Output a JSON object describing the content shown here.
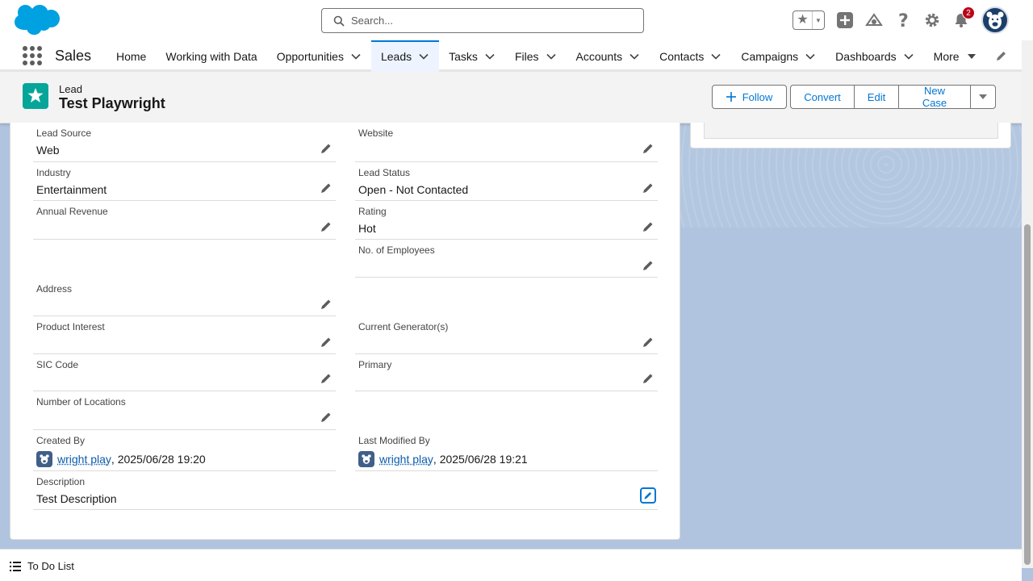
{
  "header": {
    "search_placeholder": "Search...",
    "notification_count": "2"
  },
  "nav": {
    "app_name": "Sales",
    "items": [
      {
        "label": "Home",
        "dropdown": false,
        "active": false
      },
      {
        "label": "Working with Data",
        "dropdown": false,
        "active": false
      },
      {
        "label": "Opportunities",
        "dropdown": true,
        "active": false
      },
      {
        "label": "Leads",
        "dropdown": true,
        "active": true
      },
      {
        "label": "Tasks",
        "dropdown": true,
        "active": false
      },
      {
        "label": "Files",
        "dropdown": true,
        "active": false
      },
      {
        "label": "Accounts",
        "dropdown": true,
        "active": false
      },
      {
        "label": "Contacts",
        "dropdown": true,
        "active": false
      },
      {
        "label": "Campaigns",
        "dropdown": true,
        "active": false
      },
      {
        "label": "Dashboards",
        "dropdown": true,
        "active": false
      },
      {
        "label": "More",
        "dropdown": true,
        "active": false
      }
    ]
  },
  "record": {
    "type": "Lead",
    "title": "Test Playwright",
    "actions": {
      "follow": "Follow",
      "convert": "Convert",
      "edit": "Edit",
      "new_case": "New Case"
    }
  },
  "fields": {
    "lead_source": {
      "label": "Lead Source",
      "value": "Web"
    },
    "website": {
      "label": "Website",
      "value": ""
    },
    "industry": {
      "label": "Industry",
      "value": "Entertainment"
    },
    "lead_status": {
      "label": "Lead Status",
      "value": "Open - Not Contacted"
    },
    "annual_revenue": {
      "label": "Annual Revenue",
      "value": ""
    },
    "rating": {
      "label": "Rating",
      "value": "Hot"
    },
    "employees": {
      "label": "No. of Employees",
      "value": ""
    },
    "address": {
      "label": "Address",
      "value": ""
    },
    "product_interest": {
      "label": "Product Interest",
      "value": ""
    },
    "current_generators": {
      "label": "Current Generator(s)",
      "value": ""
    },
    "sic_code": {
      "label": "SIC Code",
      "value": ""
    },
    "primary": {
      "label": "Primary",
      "value": ""
    },
    "num_locations": {
      "label": "Number of Locations",
      "value": ""
    },
    "created_by": {
      "label": "Created By",
      "user": "wright play",
      "date": ", 2025/06/28 19:20"
    },
    "last_modified_by": {
      "label": "Last Modified By",
      "user": "wright play",
      "date": ", 2025/06/28 19:21"
    },
    "description": {
      "label": "Description",
      "value": "Test Description"
    }
  },
  "footer": {
    "todo_label": "To Do List"
  }
}
